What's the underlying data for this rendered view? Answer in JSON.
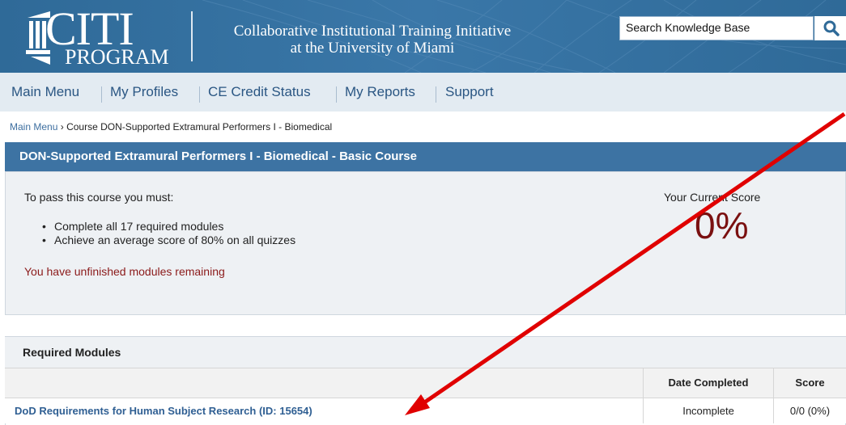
{
  "header": {
    "logo_main": "CITI",
    "logo_sub": "PROGRAM",
    "org_line1": "Collaborative Institutional Training Initiative",
    "org_line2": "at the University of Miami"
  },
  "search": {
    "placeholder": "Search Knowledge Base",
    "icon": "search-icon"
  },
  "nav": {
    "items": [
      "Main Menu",
      "My Profiles",
      "CE Credit Status",
      "My Reports",
      "Support"
    ]
  },
  "breadcrumb": {
    "home": "Main Menu",
    "separator": "›",
    "current": "Course DON-Supported Extramural Performers I - Biomedical"
  },
  "course": {
    "title": "DON-Supported Extramural Performers I - Biomedical - Basic Course",
    "pass_intro": "To pass this course you must:",
    "requirements": [
      "Complete all 17 required modules",
      "Achieve an average score of 80% on all quizzes"
    ],
    "status_message": "You have unfinished modules remaining",
    "score_label": "Your Current Score",
    "score_value": "0%"
  },
  "modules": {
    "title": "Required Modules",
    "columns": [
      "Date Completed",
      "Score"
    ],
    "rows": [
      {
        "name": "DoD Requirements for Human Subject Research (ID: 15654)",
        "date": "Incomplete",
        "score": "0/0 (0%)"
      }
    ]
  },
  "colors": {
    "header_blue": "#3a77a8",
    "nav_bg": "#e3ebf2",
    "course_bar": "#3d73a3",
    "score_red": "#7a1010",
    "annotation_arrow": "#e00000"
  }
}
